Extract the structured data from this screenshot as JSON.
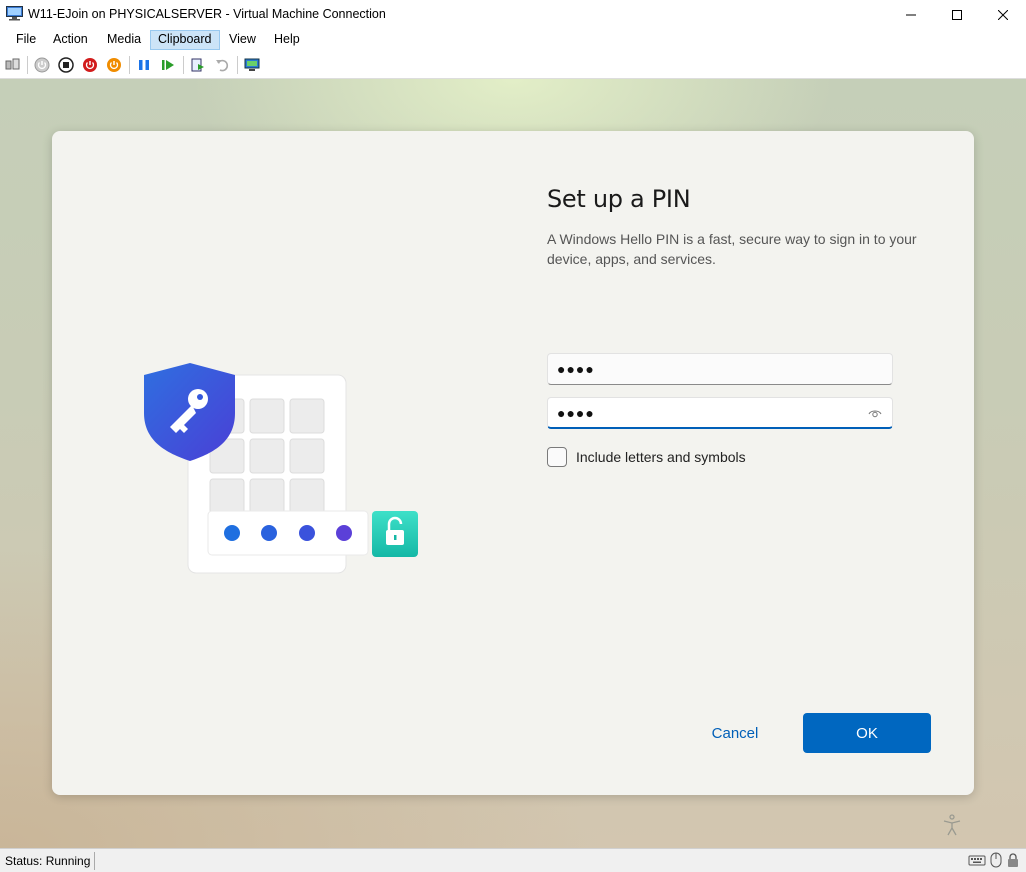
{
  "window": {
    "title": "W11-EJoin on PHYSICALSERVER - Virtual Machine Connection",
    "minimize_icon": "minimize-icon",
    "maximize_icon": "maximize-icon",
    "close_icon": "close-icon"
  },
  "menu": {
    "items": [
      "File",
      "Action",
      "Media",
      "Clipboard",
      "View",
      "Help"
    ],
    "active": "Clipboard"
  },
  "toolbar": {
    "icons": [
      "ctrl-alt-del-icon",
      "start-icon",
      "turn-off-icon",
      "shut-down-icon",
      "save-icon",
      "pause-icon",
      "resume-icon",
      "checkpoint-icon",
      "revert-icon",
      "enhanced-session-icon"
    ]
  },
  "dialog": {
    "heading": "Set up a PIN",
    "description": "A Windows Hello PIN is a fast, secure way to sign in to your device, apps, and services.",
    "pin_value": "●●●●",
    "confirm_pin_value": "●●●●",
    "checkbox_label": "Include letters and symbols",
    "checkbox_checked": false,
    "cancel_label": "Cancel",
    "ok_label": "OK",
    "accent_color": "#0067c0"
  },
  "status": {
    "text": "Status: Running"
  }
}
